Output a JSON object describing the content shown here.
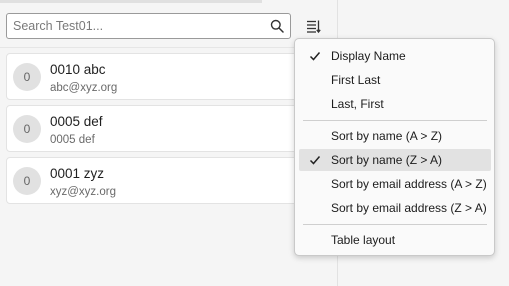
{
  "search": {
    "placeholder": "Search Test01..."
  },
  "contacts": [
    {
      "avatar": "0",
      "name": "0010 abc",
      "email": "abc@xyz.org"
    },
    {
      "avatar": "0",
      "name": "0005 def",
      "email": "0005 def"
    },
    {
      "avatar": "0",
      "name": "0001 zyz",
      "email": "xyz@xyz.org"
    }
  ],
  "menu": {
    "display_name": "Display Name",
    "first_last": "First Last",
    "last_first": "Last, First",
    "sort_name_asc": "Sort by name (A > Z)",
    "sort_name_desc": "Sort by name (Z > A)",
    "sort_email_asc": "Sort by email address (A > Z)",
    "sort_email_desc": "Sort by email address (Z > A)",
    "table_layout": "Table layout"
  },
  "icons": {
    "search": "search-icon",
    "layout": "list-layout-icon",
    "check": "checkmark-icon"
  },
  "colors": {
    "highlight": "#e2e2e2",
    "avatar_bg": "#e1e1e1"
  }
}
